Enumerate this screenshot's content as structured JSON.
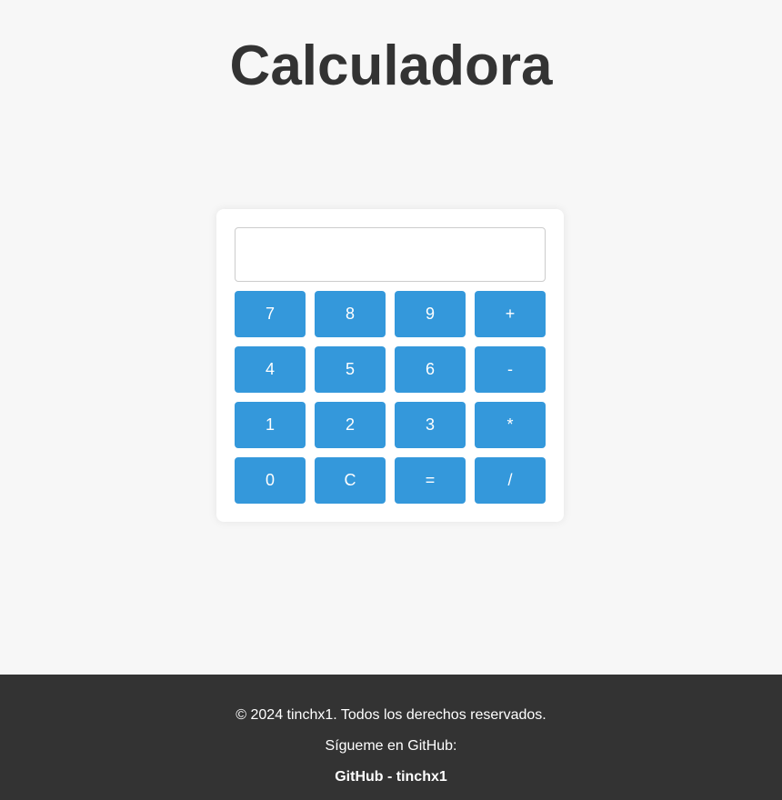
{
  "header": {
    "title": "Calculadora"
  },
  "calculator": {
    "display_value": "",
    "keys": [
      {
        "label": "7",
        "name": "key-7"
      },
      {
        "label": "8",
        "name": "key-8"
      },
      {
        "label": "9",
        "name": "key-9"
      },
      {
        "label": "+",
        "name": "key-add"
      },
      {
        "label": "4",
        "name": "key-4"
      },
      {
        "label": "5",
        "name": "key-5"
      },
      {
        "label": "6",
        "name": "key-6"
      },
      {
        "label": "-",
        "name": "key-subtract"
      },
      {
        "label": "1",
        "name": "key-1"
      },
      {
        "label": "2",
        "name": "key-2"
      },
      {
        "label": "3",
        "name": "key-3"
      },
      {
        "label": "*",
        "name": "key-multiply"
      },
      {
        "label": "0",
        "name": "key-0"
      },
      {
        "label": "C",
        "name": "key-clear"
      },
      {
        "label": "=",
        "name": "key-equals"
      },
      {
        "label": "/",
        "name": "key-divide"
      }
    ]
  },
  "footer": {
    "copyright": "© 2024 tinchx1. Todos los derechos reservados.",
    "follow_text": "Sígueme en GitHub:",
    "github_link": "GitHub - tinchx1"
  },
  "colors": {
    "background": "#f7f7f7",
    "key_blue": "#3498db",
    "footer_bg": "#333333",
    "title_text": "#333333"
  }
}
